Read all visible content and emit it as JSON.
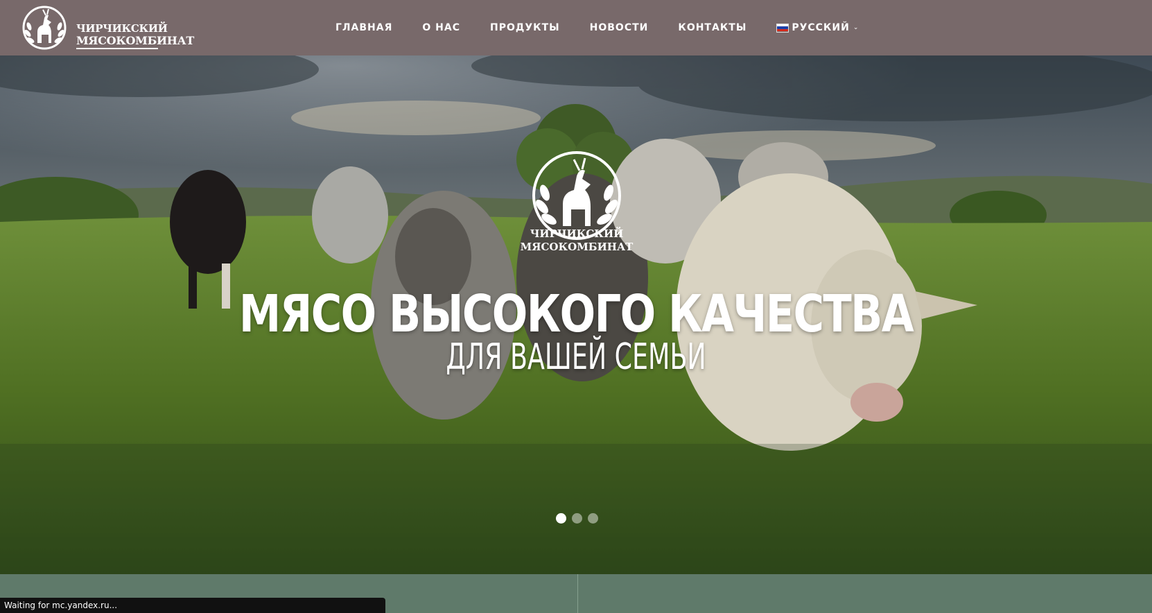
{
  "brand": {
    "line1": "ЧИРЧИКСКИЙ",
    "line2": "МЯСОКОМБИНАТ"
  },
  "nav": {
    "items": [
      "ГЛАВНАЯ",
      "О НАС",
      "ПРОДУКТЫ",
      "НОВОСТИ",
      "КОНТАКТЫ"
    ],
    "language": {
      "label": "РУССКИЙ",
      "icon": "russia-flag-icon"
    }
  },
  "hero": {
    "logo_line1": "ЧИРЧИКСКИЙ",
    "logo_line2": "МЯСОКОМБИНАТ",
    "title": "МЯСО ВЫСОКОГО КАЧЕСТВА",
    "subtitle": "ДЛЯ ВАШЕЙ СЕМЬИ",
    "slides": 3,
    "active_slide": 1
  },
  "status_bar": {
    "text": "Waiting for mc.yandex.ru..."
  },
  "colors": {
    "header": "#78696a",
    "bottom": "#5f7a6a",
    "grass": "#5a7a2e",
    "sky": "#5d6d78"
  }
}
